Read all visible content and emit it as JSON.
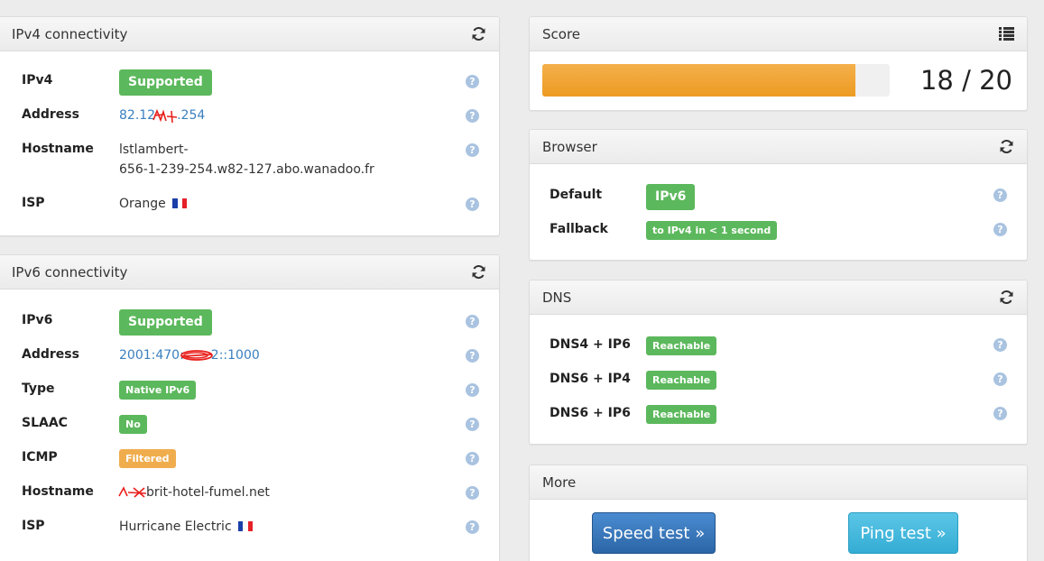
{
  "ipv4_panel": {
    "title": "IPv4 connectivity",
    "rows": {
      "ipv4": {
        "label": "IPv4",
        "badge": "Supported"
      },
      "address": {
        "label": "Address",
        "value_pre": "82.12",
        "value_post": ".254"
      },
      "hostname": {
        "label": "Hostname",
        "line1": "lstlambert-",
        "line2": "656-1-239-254.w82-127.abo.wanadoo.fr"
      },
      "isp": {
        "label": "ISP",
        "value": "Orange"
      }
    }
  },
  "ipv6_panel": {
    "title": "IPv6 connectivity",
    "rows": {
      "ipv6": {
        "label": "IPv6",
        "badge": "Supported"
      },
      "address": {
        "label": "Address",
        "value_pre": "2001:470:",
        "value_post": "2::1000"
      },
      "type": {
        "label": "Type",
        "badge": "Native IPv6"
      },
      "slaac": {
        "label": "SLAAC",
        "badge": "No"
      },
      "icmp": {
        "label": "ICMP",
        "badge": "Filtered"
      },
      "hostname": {
        "label": "Hostname",
        "value": "brit-hotel-fumel.net"
      },
      "isp": {
        "label": "ISP",
        "value": "Hurricane Electric"
      }
    }
  },
  "score_panel": {
    "title": "Score",
    "score": 18,
    "max": 20,
    "score_text": "18 / 20"
  },
  "browser_panel": {
    "title": "Browser",
    "rows": {
      "default": {
        "label": "Default",
        "badge": "IPv6"
      },
      "fallback": {
        "label": "Fallback",
        "badge": "to IPv4 in < 1 second"
      }
    }
  },
  "dns_panel": {
    "title": "DNS",
    "rows": [
      {
        "label": "DNS4 + IP6",
        "badge": "Reachable"
      },
      {
        "label": "DNS6 + IP4",
        "badge": "Reachable"
      },
      {
        "label": "DNS6 + IP6",
        "badge": "Reachable"
      }
    ]
  },
  "more_panel": {
    "title": "More",
    "speed_test": "Speed test »",
    "ping_test": "Ping test »"
  },
  "help_glyph": "?",
  "colors": {
    "success": "#5cb85c",
    "warning": "#f0ad4e",
    "link": "#3a7fbf",
    "primary": "#2b66a7",
    "info": "#34acd4"
  },
  "icons": {
    "refresh": "refresh-icon",
    "list": "list-icon",
    "help": "help-icon",
    "flag_fr": "flag-france-icon"
  }
}
